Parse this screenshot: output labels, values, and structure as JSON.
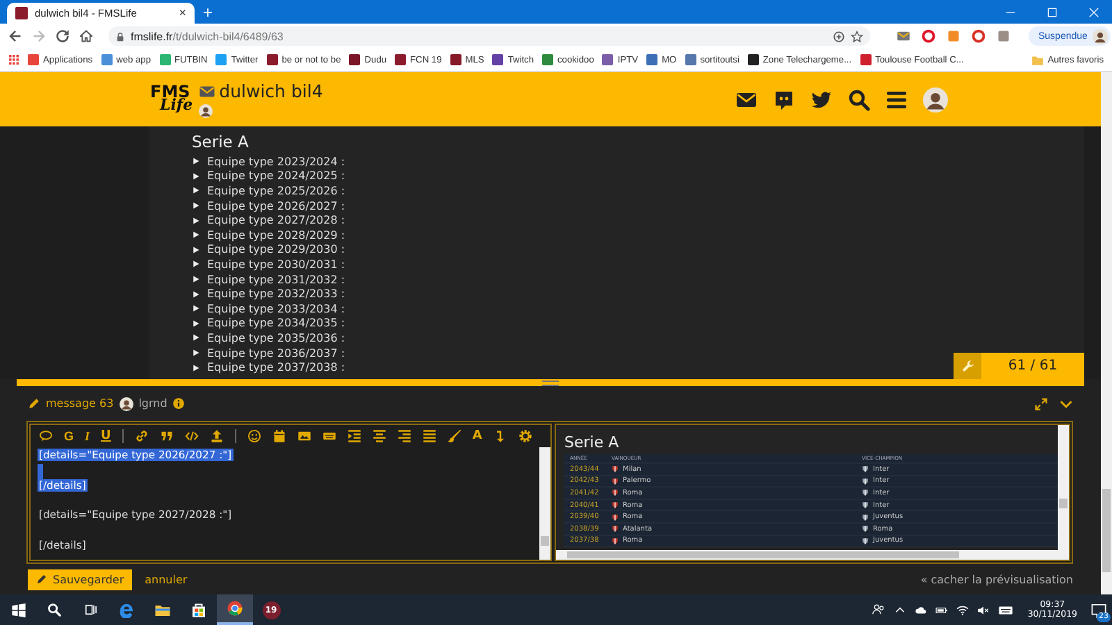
{
  "browser": {
    "tab_title": "dulwich bil4 - FMSLife",
    "tab_close": "×",
    "new_tab": "+",
    "url": {
      "domain": "fmslife.fr",
      "path": "/t/dulwich-bil4/6489/63"
    },
    "profile": "Suspendue",
    "bookmarks": [
      {
        "label": "Applications",
        "color": "#e8453c"
      },
      {
        "label": "web app",
        "color": "#4a90d9"
      },
      {
        "label": "FUTBIN",
        "color": "#2bb673"
      },
      {
        "label": "Twitter",
        "color": "#1da1f2"
      },
      {
        "label": "be or not to be",
        "color": "#8b1a2b"
      },
      {
        "label": "Dudu",
        "color": "#7a1626"
      },
      {
        "label": "FCN 19",
        "color": "#8c1c2c"
      },
      {
        "label": "MLS",
        "color": "#861a29"
      },
      {
        "label": "Twitch",
        "color": "#6441a5"
      },
      {
        "label": "cookidoo",
        "color": "#2e8b3d"
      },
      {
        "label": "IPTV",
        "color": "#7b5ea7"
      },
      {
        "label": "MO",
        "color": "#3b6fb6"
      },
      {
        "label": "sortitoutsi",
        "color": "#5577aa"
      },
      {
        "label": "Zone Telechargeme...",
        "color": "#222222"
      },
      {
        "label": "Toulouse Football C...",
        "color": "#d0202e"
      }
    ],
    "other_bookmarks": "Autres favoris"
  },
  "site_header": {
    "logo": [
      "FMS",
      "Life"
    ],
    "topic_title": "dulwich bil4"
  },
  "post": {
    "heading": "Serie A",
    "items": [
      "Equipe type 2023/2024 :",
      "Equipe type 2024/2025 :",
      "Equipe type 2025/2026 :",
      "Equipe type 2026/2027 :",
      "Equipe type 2027/2028 :",
      "Equipe type 2028/2029 :",
      "Equipe type 2029/2030 :",
      "Equipe type 2030/2031 :",
      "Equipe type 2031/2032 :",
      "Equipe type 2032/2033 :",
      "Equipe type 2033/2034 :",
      "Equipe type 2034/2035 :",
      "Equipe type 2035/2036 :",
      "Equipe type 2036/2037 :",
      "Equipe type 2037/2038 :"
    ]
  },
  "progress": {
    "counter": "61 / 61"
  },
  "composer": {
    "action": "message 63",
    "username": "lgrnd",
    "toolbar_letters": [
      "G",
      "I",
      "U",
      "A"
    ],
    "lines": [
      {
        "kind": "text",
        "text": "[details=\"Equipe type 2026/2027 :\"]",
        "selected": true
      },
      {
        "kind": "blank",
        "selected": true
      },
      {
        "kind": "text",
        "text": "[/details]",
        "selected": true
      },
      {
        "kind": "blank",
        "selected": false
      },
      {
        "kind": "text",
        "text": "[details=\"Equipe type 2027/2028 :\"]",
        "selected": false
      },
      {
        "kind": "blank",
        "selected": false
      },
      {
        "kind": "text",
        "text": "[/details]",
        "selected": false
      }
    ],
    "preview": {
      "heading": "Serie A",
      "columns": [
        "ANNÉE",
        "VAINQUEUR",
        "VICE-CHAMPION"
      ],
      "rows": [
        {
          "year": "2043/44",
          "winner": "Milan",
          "runner_up": "Inter"
        },
        {
          "year": "2042/43",
          "winner": "Palermo",
          "runner_up": "Inter"
        },
        {
          "year": "2041/42",
          "winner": "Roma",
          "runner_up": "Inter"
        },
        {
          "year": "2040/41",
          "winner": "Roma",
          "runner_up": "Inter"
        },
        {
          "year": "2039/40",
          "winner": "Roma",
          "runner_up": "Juventus"
        },
        {
          "year": "2038/39",
          "winner": "Atalanta",
          "runner_up": "Roma"
        },
        {
          "year": "2037/38",
          "winner": "Roma",
          "runner_up": "Juventus"
        }
      ]
    },
    "save": "Sauvegarder",
    "cancel": "annuler",
    "hide_preview": "« cacher la prévisualisation"
  },
  "taskbar": {
    "app_label": "19",
    "time": "09:37",
    "date": "30/11/2019",
    "notifications": "23"
  }
}
